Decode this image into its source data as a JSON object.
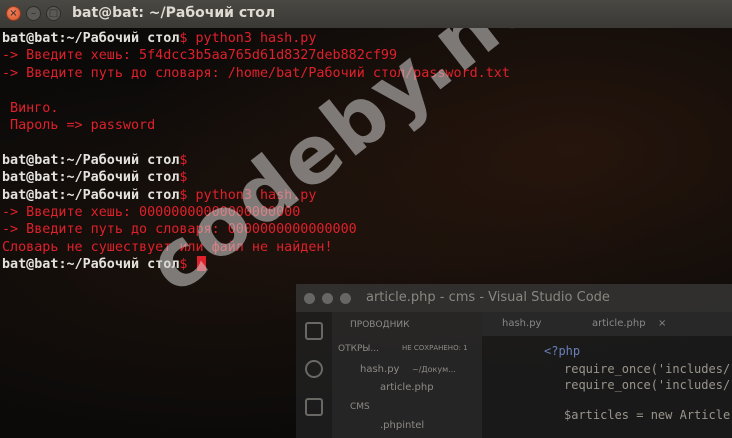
{
  "window": {
    "title": "bat@bat: ~/Рабочий стол",
    "close_glyph": "×",
    "min_glyph": "–",
    "max_glyph": "□"
  },
  "terminal": {
    "lines": [
      [
        {
          "t": "bat@bat",
          "c": "w"
        },
        {
          "t": ":~/Рабочий стол",
          "c": "w"
        },
        {
          "t": "$ python3 hash.py",
          "c": "r"
        }
      ],
      [
        {
          "t": "-> Введите хешь: 5f4dcc3b5aa765d61d8327deb882cf99",
          "c": "r"
        }
      ],
      [
        {
          "t": "-> Введите путь до словаря: /home/bat/Рабочий стол/password.txt",
          "c": "r"
        }
      ],
      [
        {
          "t": "",
          "c": "r"
        }
      ],
      [
        {
          "t": " Винго.",
          "c": "r"
        }
      ],
      [
        {
          "t": " Пароль => password",
          "c": "r"
        }
      ],
      [
        {
          "t": "",
          "c": "r"
        }
      ],
      [
        {
          "t": "bat@bat",
          "c": "w"
        },
        {
          "t": ":~/Рабочий стол",
          "c": "w"
        },
        {
          "t": "$",
          "c": "r"
        }
      ],
      [
        {
          "t": "bat@bat",
          "c": "w"
        },
        {
          "t": ":~/Рабочий стол",
          "c": "w"
        },
        {
          "t": "$",
          "c": "r"
        }
      ],
      [
        {
          "t": "bat@bat",
          "c": "w"
        },
        {
          "t": ":~/Рабочий стол",
          "c": "w"
        },
        {
          "t": "$ python3 hash.py",
          "c": "r"
        }
      ],
      [
        {
          "t": "-> Введите хешь: 00000000000000000000",
          "c": "r"
        }
      ],
      [
        {
          "t": "-> Введите путь до словаря: 0000000000000000",
          "c": "r"
        }
      ],
      [
        {
          "t": "Словарь не сушествует или файл не найден!",
          "c": "r"
        }
      ],
      [
        {
          "t": "bat@bat",
          "c": "w"
        },
        {
          "t": ":~/Рабочий стол",
          "c": "w"
        },
        {
          "t": "$ ",
          "c": "r"
        }
      ]
    ]
  },
  "background_window": {
    "title": "article.php - cms - Visual Studio Code",
    "explorer_label": "ПРОВОДНИК",
    "open_editors_label": "ОТКРЫ...",
    "unsaved_label": "НЕ СОХРАНЕНО: 1",
    "open_file_1": "hash.py",
    "open_file_1_path": "~/Докум...",
    "open_file_2": "article.php",
    "folder_label": "CMS",
    "folder_item": ".phpintel",
    "tab_1": "hash.py",
    "tab_2": "article.php",
    "tab_close": "×",
    "code_1": "<?php",
    "code_2": "require_once('includes/",
    "code_3": "require_once('includes/",
    "code_4": "$articles = new Article"
  },
  "watermark": "codeby.net",
  "colors": {
    "prompt": "#e4e2dc",
    "text_red": "#e0202a",
    "titlebar": "#3f3e3a",
    "background": "#0b0a09"
  }
}
